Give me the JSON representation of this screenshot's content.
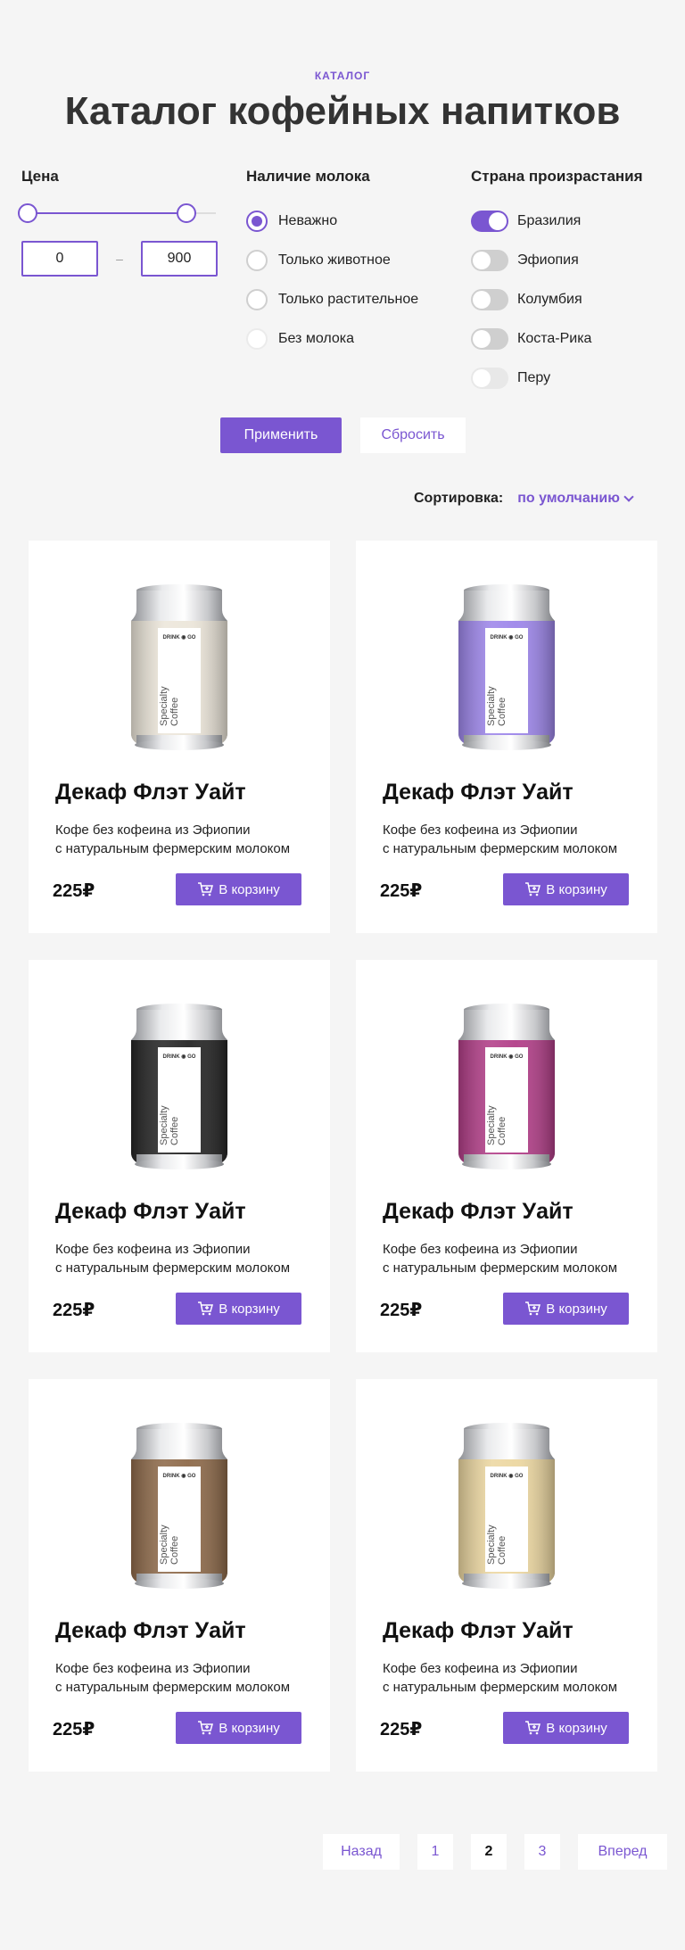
{
  "header": {
    "eyebrow": "КАТАЛОГ",
    "title": "Каталог кофейных напитков"
  },
  "filters": {
    "price": {
      "label": "Цена",
      "min_value": "0",
      "max_value": "900",
      "separator": "–"
    },
    "milk": {
      "label": "Наличие молока",
      "options": [
        {
          "label": "Неважно",
          "selected": true
        },
        {
          "label": "Только животное",
          "selected": false
        },
        {
          "label": "Только растительное",
          "selected": false
        },
        {
          "label": "Без молока",
          "selected": false,
          "disabled": true
        }
      ]
    },
    "country": {
      "label": "Страна произрастания",
      "options": [
        {
          "label": "Бразилия",
          "on": true
        },
        {
          "label": "Эфиопия",
          "on": false
        },
        {
          "label": "Колумбия",
          "on": false
        },
        {
          "label": "Коста-Рика",
          "on": false
        },
        {
          "label": "Перу",
          "on": false,
          "disabled": true
        }
      ]
    },
    "apply_label": "Применить",
    "reset_label": "Сбросить"
  },
  "sort": {
    "label": "Сортировка:",
    "value": "по умолчанию"
  },
  "products": [
    {
      "title": "Декаф Флэт Уайт",
      "desc_line1": "Кофе без кофеина из Эфиопии",
      "desc_line2": "с натуральным фермерским молоком",
      "price": "225₽",
      "button": "В корзину",
      "can_color": "#ece6da",
      "can_brand": "DRINK ◉ GO",
      "can_text1": "Specialty",
      "can_text2": "Coffee"
    },
    {
      "title": "Декаф Флэт Уайт",
      "desc_line1": "Кофе без кофеина из Эфиопии",
      "desc_line2": "с натуральным фермерским молоком",
      "price": "225₽",
      "button": "В корзину",
      "can_color": "#9d86ea",
      "can_brand": "DRINK ◉ GO",
      "can_text1": "Specialty",
      "can_text2": "Coffee"
    },
    {
      "title": "Декаф Флэт Уайт",
      "desc_line1": "Кофе без кофеина из Эфиопии",
      "desc_line2": "с натуральным фермерским молоком",
      "price": "225₽",
      "button": "В корзину",
      "can_color": "#252525",
      "can_brand": "DRINK ◉ GO",
      "can_text1": "Specialty",
      "can_text2": "Coffee"
    },
    {
      "title": "Декаф Флэт Уайт",
      "desc_line1": "Кофе без кофеина из Эфиопии",
      "desc_line2": "с натуральным фермерским молоком",
      "price": "225₽",
      "button": "В корзину",
      "can_color": "#b23e88",
      "can_brand": "DRINK ◉ GO",
      "can_text1": "Specialty",
      "can_text2": "Coffee"
    },
    {
      "title": "Декаф Флэт Уайт",
      "desc_line1": "Кофе без кофеина из Эфиопии",
      "desc_line2": "с натуральным фермерским молоком",
      "price": "225₽",
      "button": "В корзину",
      "can_color": "#8e6a4a",
      "can_brand": "DRINK ◉ GO",
      "can_text1": "Specialty",
      "can_text2": "Coffee"
    },
    {
      "title": "Декаф Флэт Уайт",
      "desc_line1": "Кофе без кофеина из Эфиопии",
      "desc_line2": "с натуральным фермерским молоком",
      "price": "225₽",
      "button": "В корзину",
      "can_color": "#ecd7a1",
      "can_brand": "DRINK ◉ GO",
      "can_text1": "Specialty",
      "can_text2": "Coffee"
    }
  ],
  "pagination": {
    "prev": "Назад",
    "pages": [
      "1",
      "2",
      "3"
    ],
    "current": "2",
    "next": "Вперед"
  },
  "colors": {
    "accent": "#7a56d1",
    "background": "#f5f5f5"
  }
}
